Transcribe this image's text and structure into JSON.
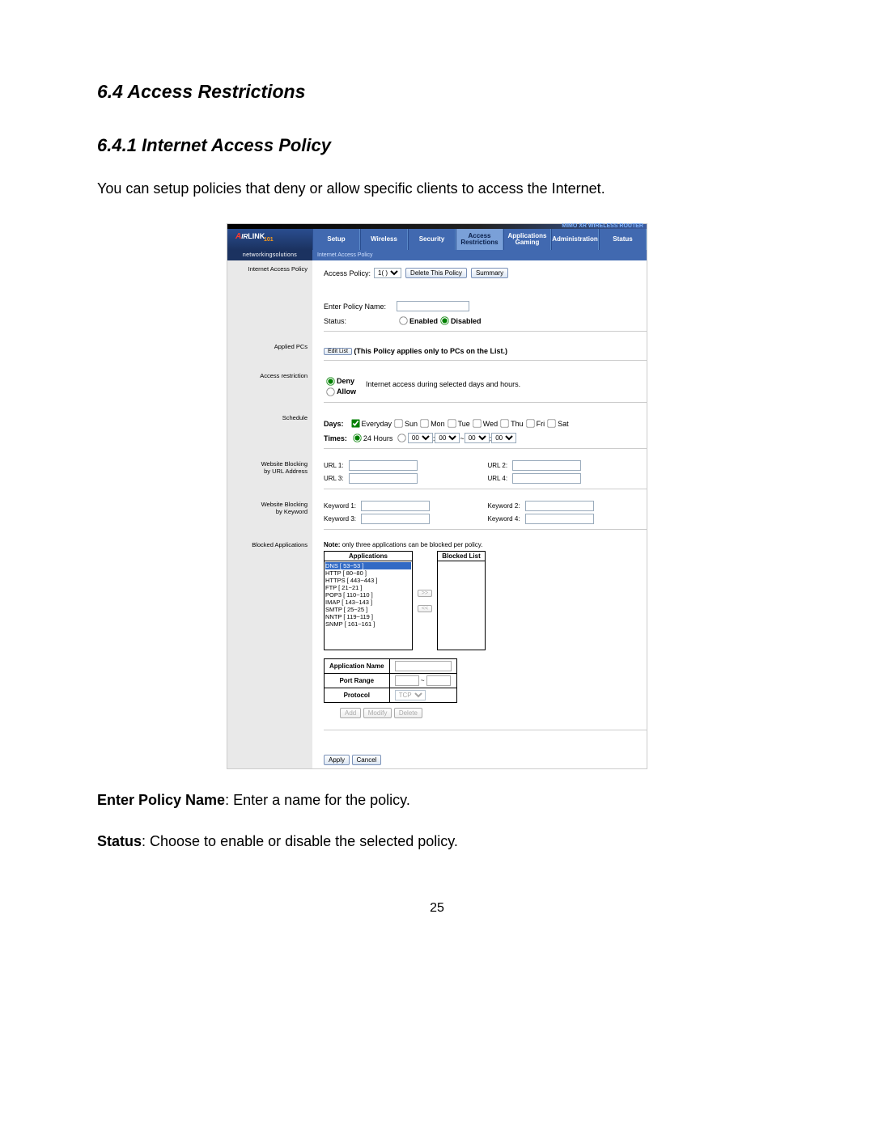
{
  "doc": {
    "h1": "6.4 Access Restrictions",
    "h2": "6.4.1 Internet Access Policy",
    "intro": "You can setup policies that deny or allow specific clients to access the Internet.",
    "desc1_label": "Enter Policy Name",
    "desc1_text": ": Enter a name for the policy.",
    "desc2_label": "Status",
    "desc2_text": ": Choose to enable or disable the selected policy.",
    "page": "25"
  },
  "router": {
    "model": "MIMO XR\nWIRELESS ROUTER",
    "logo_a": "A",
    "logo_ir": "IR",
    "logo_link": "LINK",
    "logo_101": "101",
    "tagline": "networkingsolutions",
    "nav": {
      "setup": "Setup",
      "wireless": "Wireless",
      "security": "Security",
      "access": "Access Restrictions",
      "apps": "Applications Gaming",
      "admin": "Administration",
      "status": "Status"
    },
    "subbar": "Internet Access Policy",
    "side": {
      "iap": "Internet Access Policy"
    },
    "policy": {
      "label": "Access Policy:",
      "option": "1( )",
      "delete": "Delete This Policy",
      "summary": "Summary",
      "name_label": "Enter Policy Name:",
      "status_label": "Status:",
      "enabled": "Enabled",
      "disabled": "Disabled"
    },
    "applied": {
      "l": "Applied PCs",
      "btn": "Edit List",
      "note": "(This Policy applies only to PCs on the List.)"
    },
    "restrict": {
      "l": "Access restriction",
      "deny": "Deny",
      "allow": "Allow",
      "note": "Internet access during selected days and hours."
    },
    "sched": {
      "l": "Schedule",
      "days_lbl": "Days:",
      "everyday": "Everyday",
      "sun": "Sun",
      "mon": "Mon",
      "tue": "Tue",
      "wed": "Wed",
      "thu": "Thu",
      "fri": "Fri",
      "sat": "Sat",
      "times_lbl": "Times:",
      "h24": "24 Hours",
      "t_opt": "00"
    },
    "urlblk": {
      "l1": "Website Blocking",
      "l2": "by URL Address",
      "u1": "URL 1:",
      "u2": "URL 2:",
      "u3": "URL 3:",
      "u4": "URL 4:"
    },
    "kwblk": {
      "l1": "Website Blocking",
      "l2": "by Keyword",
      "k1": "Keyword 1:",
      "k2": "Keyword 2:",
      "k3": "Keyword 3:",
      "k4": "Keyword 4:"
    },
    "blocked": {
      "l": "Blocked Applications",
      "note": "Note: only three applications can be blocked per policy.",
      "apps_hdr": "Applications",
      "blk_hdr": "Blocked List",
      "list": [
        "DNS [ 53~53 ]",
        "HTTP [ 80~80 ]",
        "HTTPS [ 443~443 ]",
        "FTP [ 21~21 ]",
        "POP3 [ 110~110 ]",
        "IMAP [ 143~143 ]",
        "SMTP [ 25~25 ]",
        "NNTP [ 119~119 ]",
        "SNMP [ 161~161 ]"
      ],
      "arr_r": ">>",
      "arr_l": "<<",
      "appname": "Application Name",
      "portrange": "Port Range",
      "dash": "~",
      "protocol": "Protocol",
      "proto_opt": "TCP",
      "add": "Add",
      "modify": "Modify",
      "delete": "Delete"
    },
    "footer": {
      "apply": "Apply",
      "cancel": "Cancel"
    }
  }
}
